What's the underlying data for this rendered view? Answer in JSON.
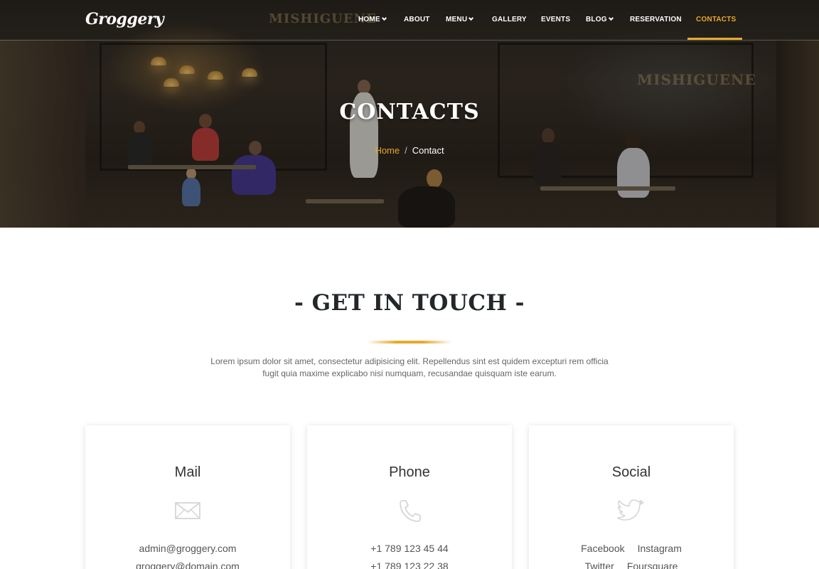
{
  "brand": {
    "logo_text": "Groggery"
  },
  "nav": {
    "items": [
      {
        "label": "HOME",
        "has_dropdown": true
      },
      {
        "label": "ABOUT",
        "has_dropdown": false
      },
      {
        "label": "MENU",
        "has_dropdown": true
      },
      {
        "label": "GALLERY",
        "has_dropdown": false
      },
      {
        "label": "EVENTS",
        "has_dropdown": false
      },
      {
        "label": "BLOG",
        "has_dropdown": true
      },
      {
        "label": "RESERVATION",
        "has_dropdown": false
      },
      {
        "label": "CONTACTS",
        "has_dropdown": false,
        "active": true
      }
    ]
  },
  "hero": {
    "sign_text": "MISHIGUENE",
    "title": "CONTACTS",
    "breadcrumb": {
      "home": "Home",
      "separator": "/",
      "current": "Contact"
    }
  },
  "section": {
    "title": "- GET IN TOUCH -",
    "intro": "Lorem ipsum dolor sit amet, consectetur adipisicing elit. Repellendus sint est quidem excepturi rem officia fugit quia maxime explicabo nisi numquam, recusandae quisquam iste earum."
  },
  "cards": {
    "mail": {
      "title": "Mail",
      "icon": "envelope-icon",
      "line1": "admin@groggery.com",
      "line2": "groggery@domain.com"
    },
    "phone": {
      "title": "Phone",
      "icon": "phone-icon",
      "line1": "+1 789 123 45 44",
      "line2": "+1 789 123 22 38"
    },
    "social": {
      "title": "Social",
      "icon": "twitter-bird-icon",
      "links": [
        "Facebook",
        "Instagram",
        "Twitter",
        "Foursquare"
      ]
    }
  },
  "colors": {
    "accent": "#e8a82b",
    "heading": "#22282a",
    "text": "#666666"
  }
}
